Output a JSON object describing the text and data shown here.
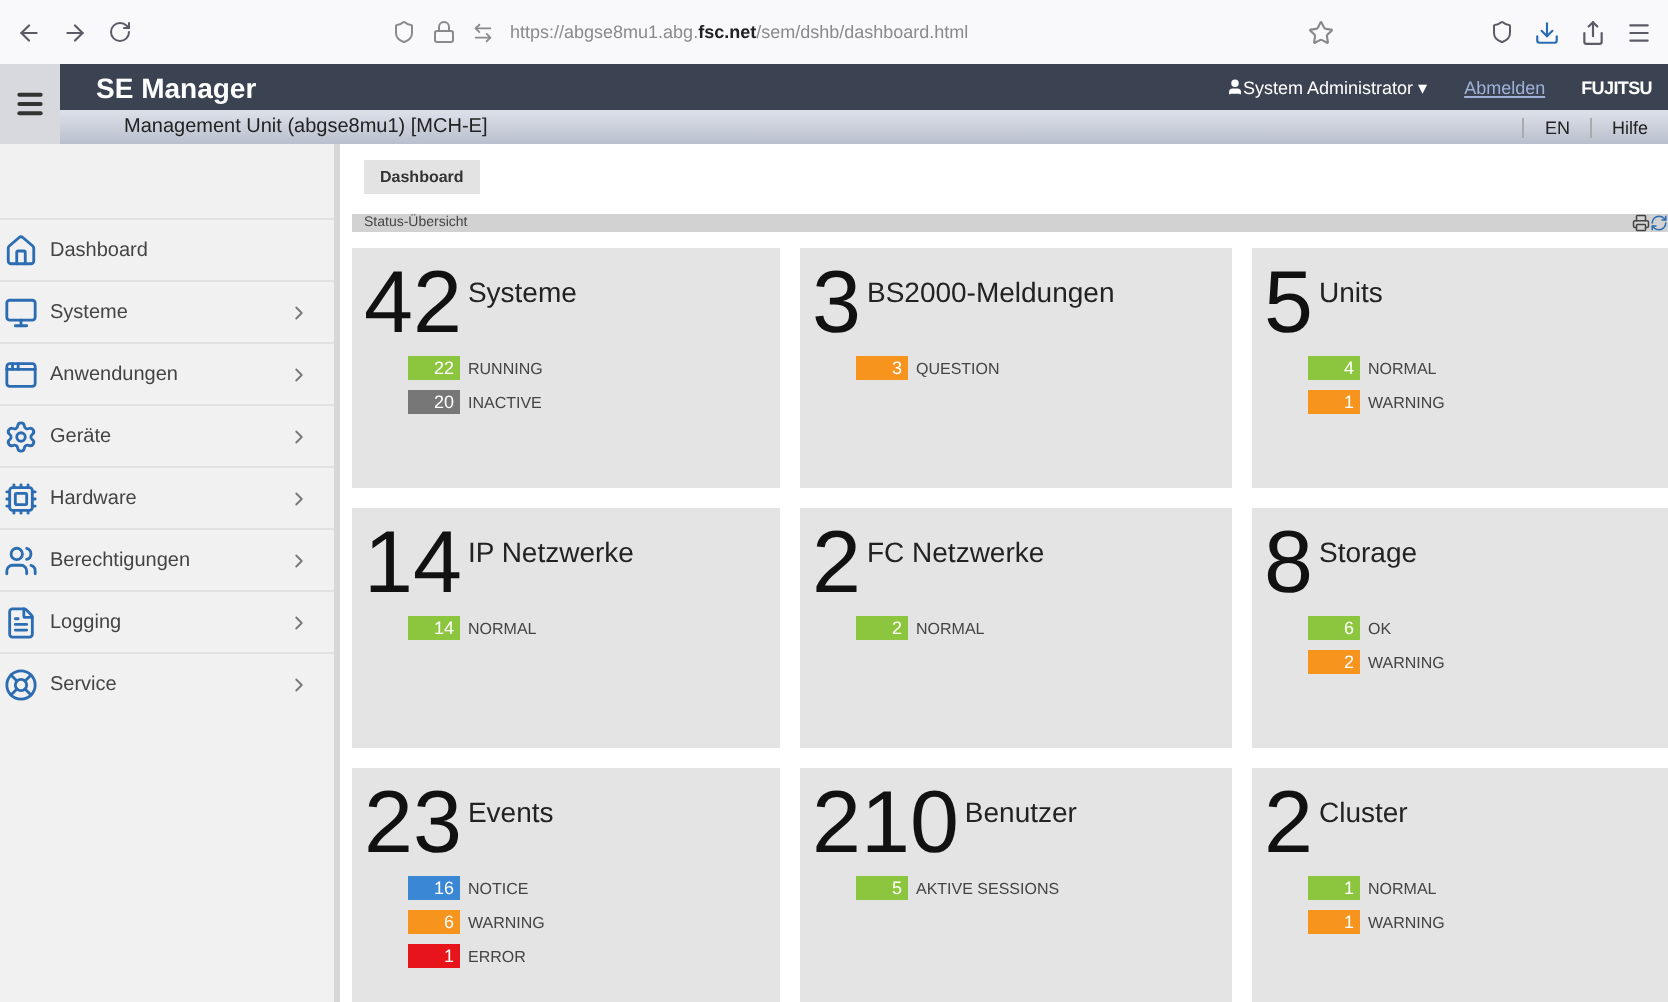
{
  "browser": {
    "url_prefix": "https://abgse8mu1.abg.",
    "url_domain": "fsc.net",
    "url_path": "/sem/dshb/dashboard.html"
  },
  "header": {
    "title": "SE Manager",
    "user": "System Administrator",
    "user_caret": "▾",
    "logout": "Abmelden",
    "brand": "FUJITSU"
  },
  "subheader": {
    "unit": "Management Unit (abgse8mu1) [MCH-E]",
    "language": "EN",
    "help": "Hilfe"
  },
  "sidebar": {
    "items": [
      {
        "label": "Dashboard",
        "expandable": false
      },
      {
        "label": "Systeme",
        "expandable": true
      },
      {
        "label": "Anwendungen",
        "expandable": true
      },
      {
        "label": "Geräte",
        "expandable": true
      },
      {
        "label": "Hardware",
        "expandable": true
      },
      {
        "label": "Berechtigungen",
        "expandable": true
      },
      {
        "label": "Logging",
        "expandable": true
      },
      {
        "label": "Service",
        "expandable": true
      }
    ]
  },
  "breadcrumb": "Dashboard",
  "section_title": "Status-Übersicht",
  "cards": [
    {
      "count": "42",
      "title": "Systeme",
      "statuses": [
        {
          "value": "22",
          "label": "RUNNING",
          "color": "#8cc63f"
        },
        {
          "value": "20",
          "label": "INACTIVE",
          "color": "#777777"
        }
      ]
    },
    {
      "count": "3",
      "title": "BS2000-Meldungen",
      "statuses": [
        {
          "value": "3",
          "label": "QUESTION",
          "color": "#f7941d"
        }
      ]
    },
    {
      "count": "5",
      "title": "Units",
      "statuses": [
        {
          "value": "4",
          "label": "NORMAL",
          "color": "#8cc63f"
        },
        {
          "value": "1",
          "label": "WARNING",
          "color": "#f7941d"
        }
      ]
    },
    {
      "count": "14",
      "title": "IP Netzwerke",
      "statuses": [
        {
          "value": "14",
          "label": "NORMAL",
          "color": "#8cc63f"
        }
      ]
    },
    {
      "count": "2",
      "title": "FC Netzwerke",
      "statuses": [
        {
          "value": "2",
          "label": "NORMAL",
          "color": "#8cc63f"
        }
      ]
    },
    {
      "count": "8",
      "title": "Storage",
      "statuses": [
        {
          "value": "6",
          "label": "OK",
          "color": "#8cc63f"
        },
        {
          "value": "2",
          "label": "WARNING",
          "color": "#f7941d"
        }
      ]
    },
    {
      "count": "23",
      "title": "Events",
      "statuses": [
        {
          "value": "16",
          "label": "NOTICE",
          "color": "#3a87d6"
        },
        {
          "value": "6",
          "label": "WARNING",
          "color": "#f7941d"
        },
        {
          "value": "1",
          "label": "ERROR",
          "color": "#e8141c"
        }
      ]
    },
    {
      "count": "210",
      "title": "Benutzer",
      "statuses": [
        {
          "value": "5",
          "label": "AKTIVE SESSIONS",
          "color": "#8cc63f"
        }
      ]
    },
    {
      "count": "2",
      "title": "Cluster",
      "statuses": [
        {
          "value": "1",
          "label": "NORMAL",
          "color": "#8cc63f"
        },
        {
          "value": "1",
          "label": "WARNING",
          "color": "#f7941d"
        }
      ]
    }
  ]
}
